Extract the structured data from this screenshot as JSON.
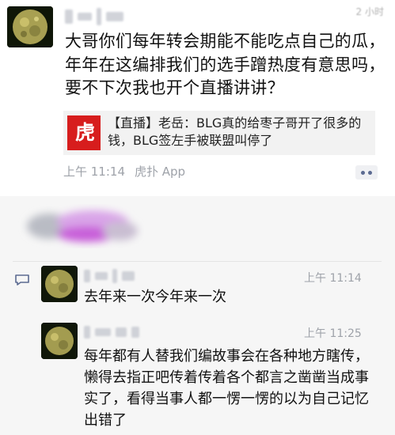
{
  "post": {
    "time_top": "2 小时",
    "text": "大哥你们每年转会期能不能吃点自己的瓜，年年在这编排我们的选手蹭热度有意思吗，要不下次我也开个直播讲讲？",
    "share": {
      "logo": "虎扑",
      "text": "【直播】老岳：BLG真的给枣子哥开了很多的钱，BLG签左手被联盟叫停了"
    },
    "footer_time": "上午 11:14",
    "footer_app": "虎扑 App"
  },
  "comments": [
    {
      "time": "上午 11:14",
      "text": "去年来一次今年来一次"
    },
    {
      "time": "上午 11:25",
      "text": "每年都有人替我们编故事会在各种地方瞎传，懒得去指正吧传着传着各个都言之凿凿当成事实了，看得当事人都一愣一愣的以为自己记忆出错了"
    }
  ],
  "colors": {
    "meta_gray": "#9ea2a9",
    "link_blue": "#5b6a91",
    "hupu_red": "#d71d1d",
    "comment_bg": "#f6f6f6"
  },
  "icons": [
    "comment-icon",
    "more-icon",
    "avatar-image"
  ]
}
